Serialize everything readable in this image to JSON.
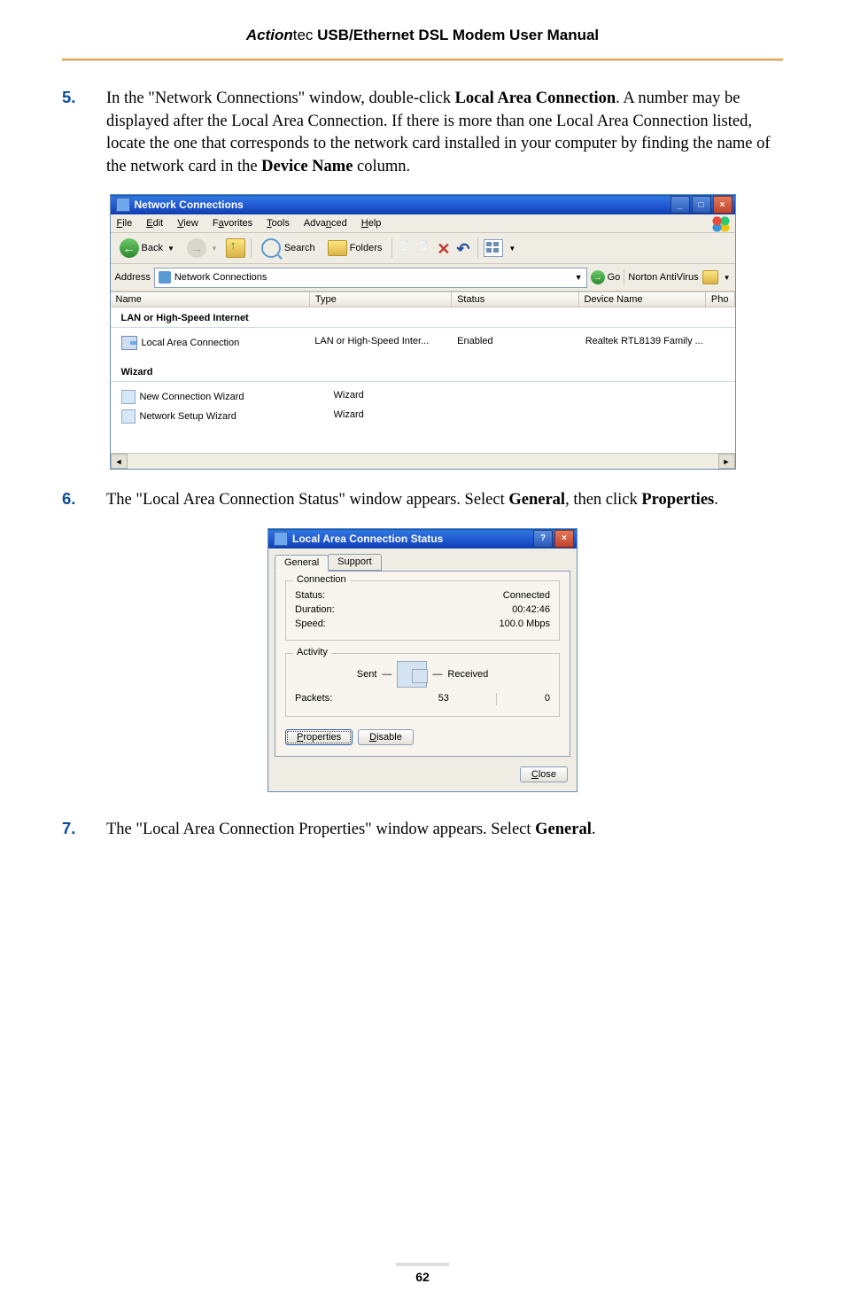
{
  "header": {
    "brand_italic": "Action",
    "brand_thin": "tec",
    "title_rest": " USB/Ethernet DSL Modem User Manual"
  },
  "steps": {
    "s5": {
      "num": "5.",
      "t1": "In the \"Network Connections\" window, double-click ",
      "b1": "Local Area Connection",
      "t2": ". A number may be displayed after the Local Area Connection. If there is more than one Local Area Connection listed, locate the one that corresponds to the network card installed in your computer by finding the name of the network card in the ",
      "b2": "Device Name",
      "t3": " column."
    },
    "s6": {
      "num": "6.",
      "t1": "The \"Local Area Connection Status\" window appears. Select ",
      "b1": "General",
      "t2": ", then click ",
      "b2": "Properties",
      "t3": "."
    },
    "s7": {
      "num": "7.",
      "t1": "The \"Local Area Connection Properties\" window appears. Select ",
      "b1": "General",
      "t2": "."
    }
  },
  "scr1": {
    "title": "Network Connections",
    "menus": {
      "file": "File",
      "edit": "Edit",
      "view": "View",
      "favorites": "Favorites",
      "tools": "Tools",
      "advanced": "Advanced",
      "help": "Help"
    },
    "toolbar": {
      "back": "Back",
      "search": "Search",
      "folders": "Folders"
    },
    "address_label": "Address",
    "address_value": "Network Connections",
    "go": "Go",
    "norton": "Norton AntiVirus",
    "cols": {
      "name": "Name",
      "type": "Type",
      "status": "Status",
      "device": "Device Name",
      "pho": "Pho"
    },
    "groups": {
      "g1": "LAN or High-Speed Internet",
      "g2": "Wizard"
    },
    "rows": {
      "r1": {
        "name": "Local Area Connection",
        "type": "LAN or High-Speed Inter...",
        "status": "Enabled",
        "device": "Realtek RTL8139 Family ..."
      },
      "r2": {
        "name": "New Connection Wizard",
        "type": "Wizard"
      },
      "r3": {
        "name": "Network Setup Wizard",
        "type": "Wizard"
      }
    }
  },
  "scr2": {
    "title": "Local Area Connection Status",
    "tabs": {
      "general": "General",
      "support": "Support"
    },
    "group1": "Connection",
    "status_k": "Status:",
    "status_v": "Connected",
    "duration_k": "Duration:",
    "duration_v": "00:42:46",
    "speed_k": "Speed:",
    "speed_v": "100.0 Mbps",
    "group2": "Activity",
    "sent": "Sent",
    "dash": "—",
    "received": "Received",
    "packets_k": "Packets:",
    "packets_sent": "53",
    "packets_recv": "0",
    "btn_properties": "Properties",
    "btn_disable": "Disable",
    "btn_close": "Close"
  },
  "page_number": "62"
}
